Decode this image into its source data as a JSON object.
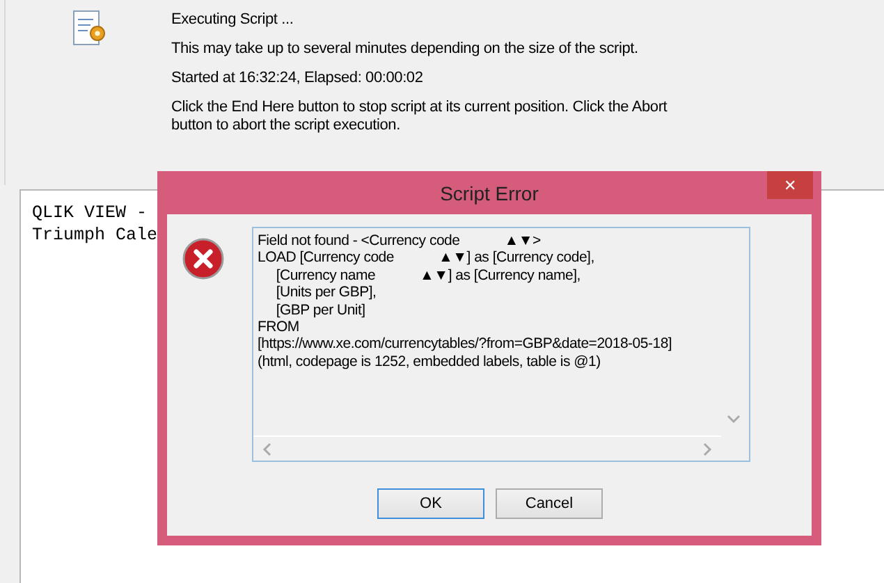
{
  "progress": {
    "status": "Executing Script ...",
    "note": "This may take up to several minutes depending on the size of the script.",
    "timing": "Started at 16:32:24, Elapsed: 00:00:02",
    "instructions": "Click the End Here button to stop script at its current position. Click the Abort button to abort the script execution."
  },
  "log": {
    "lines": [
      "QLIK VIEW -",
      "Triumph Cale"
    ]
  },
  "dialog": {
    "title": "Script Error",
    "close": "✕",
    "message_lines": [
      "Field not found - <Currency code            ▲▼>",
      "LOAD [Currency code            ▲▼] as [Currency code],",
      "     [Currency name            ▲▼] as [Currency name],",
      "     [Units per GBP],",
      "     [GBP per Unit]",
      "FROM",
      "[https://www.xe.com/currencytables/?from=GBP&date=2018-05-18]",
      "(html, codepage is 1252, embedded labels, table is @1)"
    ],
    "buttons": [
      {
        "label": "OK",
        "selected": true
      },
      {
        "label": "Cancel",
        "selected": false
      }
    ]
  }
}
